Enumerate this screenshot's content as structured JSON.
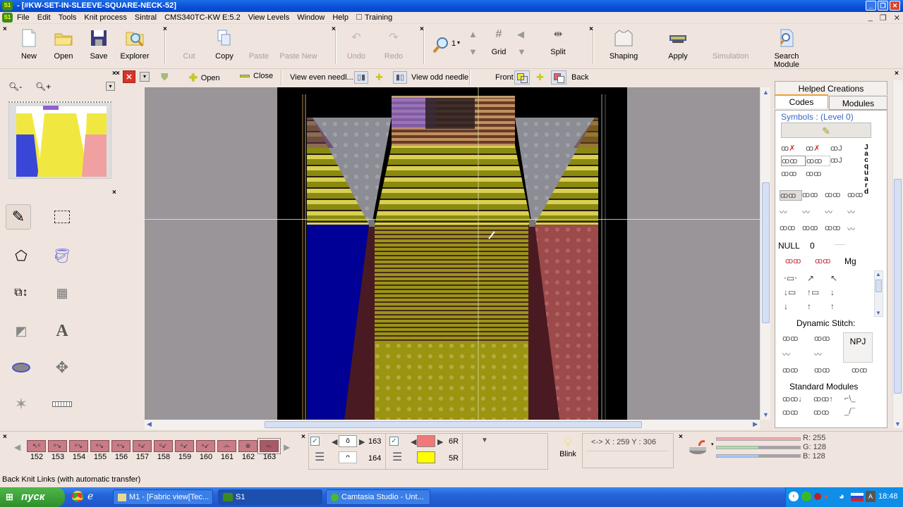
{
  "window": {
    "title": "- [#KW-SET-IN-SLEEVE-SQUARE-NECK-52]",
    "app_icon": "S1"
  },
  "menubar": {
    "items": [
      "File",
      "Edit",
      "Tools",
      "Knit process",
      "Sintral",
      "CMS340TC-KW E:5.2",
      "View Levels",
      "Window",
      "Help",
      "Training"
    ],
    "training_checked": false
  },
  "toolbar": {
    "new": "New",
    "open": "Open",
    "save": "Save",
    "explorer": "Explorer",
    "cut": "Cut",
    "copy": "Copy",
    "paste": "Paste",
    "paste_new": "Paste New",
    "undo": "Undo",
    "redo": "Redo",
    "zoom_level": "1",
    "grid": "Grid",
    "split": "Split",
    "shaping": "Shaping",
    "apply": "Apply",
    "simulation": "Simulation",
    "search_module": "Search Module"
  },
  "toolbar2": {
    "open": "Open",
    "close": "Close",
    "view_even": "View even needl...",
    "view_odd": "View odd needle.",
    "front": "Front",
    "back": "Back"
  },
  "preview": {
    "zoom_out": "-",
    "zoom_in": "+"
  },
  "right_panel": {
    "tab_helped": "Helped Creations",
    "tab_codes": "Codes",
    "tab_modules": "Modules",
    "symbols_label": "Symbols : (Level 0)",
    "jacquard_label": "Jacquard",
    "null_label": "NULL",
    "zero_label": "0",
    "dots_label": "......",
    "mg_label": "Mg",
    "dynamic_stitch": "Dynamic Stitch:",
    "npj": "NPJ",
    "standard_modules": "Standard Modules"
  },
  "stitch_bar": {
    "items": [
      "152",
      "153",
      "154",
      "155",
      "156",
      "157",
      "158",
      "159",
      "160",
      "161",
      "162",
      "163"
    ],
    "selected": "163"
  },
  "selection": {
    "stitch_primary": "163",
    "stitch_secondary": "164",
    "color_primary_label": "6R",
    "color_secondary_label": "5R",
    "color_primary": "#f07878",
    "color_secondary": "#ffff00",
    "blink": "Blink",
    "coords": "<-> X : 259  Y : 306"
  },
  "rgb": {
    "r_label": "R: 255",
    "g_label": "G: 128",
    "b_label": "B: 128",
    "r": 255,
    "g": 128,
    "b": 128
  },
  "status": {
    "text": "Back Knit Links (with automatic transfer)"
  },
  "taskbar": {
    "start": "пуск",
    "tasks": [
      "M1 - [Fabric view[Tec...",
      "S1",
      "Camtasia Studio - Unt..."
    ],
    "clock": "18:48"
  }
}
